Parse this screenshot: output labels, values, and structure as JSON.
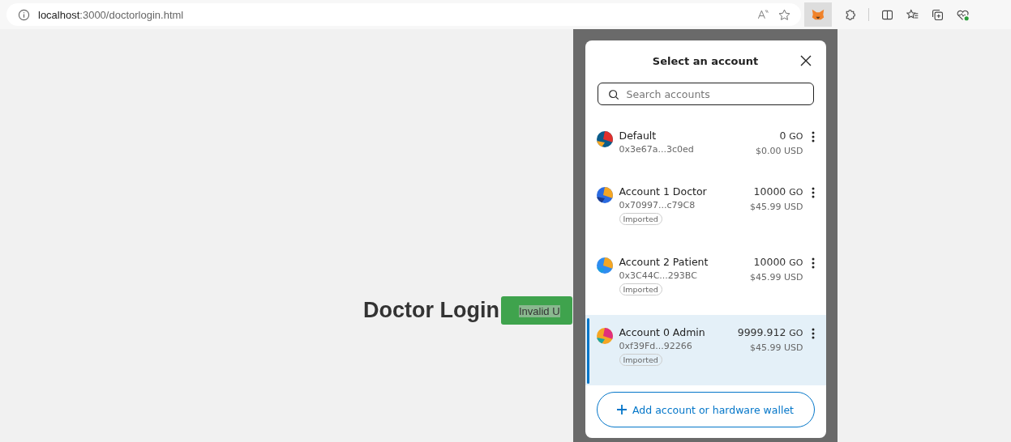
{
  "address_bar": {
    "host": "localhost",
    "path": ":3000/doctorlogin.html"
  },
  "page": {
    "heading": "Doctor Login",
    "alert": "Invalid U"
  },
  "popup": {
    "title": "Select an account",
    "search": {
      "placeholder": "Search accounts"
    },
    "accounts": [
      {
        "name": "Default",
        "address": "0x3e67a...3c0ed",
        "balance": "0",
        "unit": "GO",
        "fiat": "$0.00 USD",
        "selected": false
      },
      {
        "name": "Account 1 Doctor",
        "address": "0x70997...c79C8",
        "balance": "10000",
        "unit": "GO",
        "fiat": "$45.99 USD",
        "tag": "Imported",
        "selected": false
      },
      {
        "name": "Account 2 Patient",
        "address": "0x3C44C...293BC",
        "balance": "10000",
        "unit": "GO",
        "fiat": "$45.99 USD",
        "tag": "Imported",
        "selected": false
      },
      {
        "name": "Account 0 Admin",
        "address": "0xf39Fd...92266",
        "balance": "9999.912",
        "unit": "GO",
        "fiat": "$45.99 USD",
        "tag": "Imported",
        "selected": true
      }
    ],
    "add_button": "Add account or hardware wallet"
  }
}
